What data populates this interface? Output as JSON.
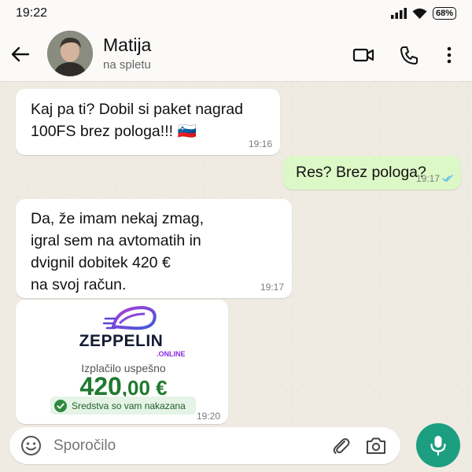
{
  "status_bar": {
    "time": "19:22",
    "battery": "68%"
  },
  "header": {
    "contact_name": "Matija",
    "contact_status": "na spletu"
  },
  "messages": [
    {
      "text_line1": "Kaj pa ti? Dobil si paket nagrad",
      "text_line2": "100FS brez pologa!!! 🇸🇮",
      "time": "19:16"
    },
    {
      "text": "Res? Brez pologa?",
      "time": "19:17"
    },
    {
      "line1": "Da, že imam nekaj zmag,",
      "line2": "igral sem na avtomatih in",
      "line3": "dvignil dobitek 420 €",
      "line4": "na svoj račun.",
      "time": "19:17"
    },
    {
      "brand": "ZEPPELIN",
      "brand_suffix": ".ONLINE",
      "payout_label": "Izplačilo uspešno",
      "amount_whole": "420",
      "amount_cents": ",00 €",
      "badge_text": "Sredstva so vam nakazana",
      "time": "19:20"
    }
  ],
  "input": {
    "placeholder": "Sporočilo"
  },
  "colors": {
    "chat_bg": "#efeae2",
    "outgoing_bubble": "#dcf8c6",
    "mic_green": "#1c9e80",
    "amount_green": "#1f7a2e",
    "tick_blue": "#53bdeb"
  },
  "icons": [
    "back-arrow-icon",
    "video-call-icon",
    "phone-icon",
    "more-options-icon",
    "emoji-icon",
    "attach-icon",
    "camera-icon",
    "mic-icon",
    "check-circle-icon",
    "double-tick-icon",
    "signal-icon",
    "wifi-icon"
  ]
}
